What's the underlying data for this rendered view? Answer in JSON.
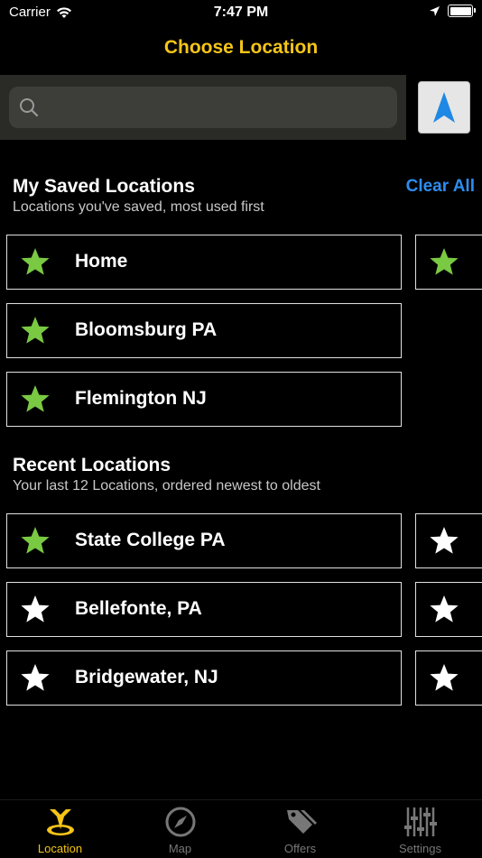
{
  "status_bar": {
    "carrier": "Carrier",
    "time": "7:47 PM"
  },
  "nav": {
    "title": "Choose Location"
  },
  "search": {
    "placeholder": ""
  },
  "saved": {
    "title": "My Saved Locations",
    "subtitle": "Locations you've saved, most used first",
    "clear_all": "Clear All",
    "items": [
      {
        "label": "Home",
        "starred": true
      },
      {
        "label": "Bloomsburg PA",
        "starred": true
      },
      {
        "label": "Flemington NJ",
        "starred": true
      }
    ]
  },
  "recent": {
    "title": "Recent Locations",
    "subtitle": "Your last 12 Locations, ordered newest to oldest",
    "items": [
      {
        "label": "State College PA",
        "starred": true
      },
      {
        "label": "Bellefonte, PA",
        "starred": false
      },
      {
        "label": "Bridgewater, NJ",
        "starred": false
      }
    ]
  },
  "tabs": [
    {
      "label": "Location",
      "icon": "location-pin-icon",
      "active": true
    },
    {
      "label": "Map",
      "icon": "compass-icon",
      "active": false
    },
    {
      "label": "Offers",
      "icon": "tags-icon",
      "active": false
    },
    {
      "label": "Settings",
      "icon": "sliders-icon",
      "active": false
    }
  ],
  "colors": {
    "accent": "#f5c518",
    "star_green": "#7ac943",
    "link_blue": "#2d8cf0",
    "background": "#000000"
  }
}
